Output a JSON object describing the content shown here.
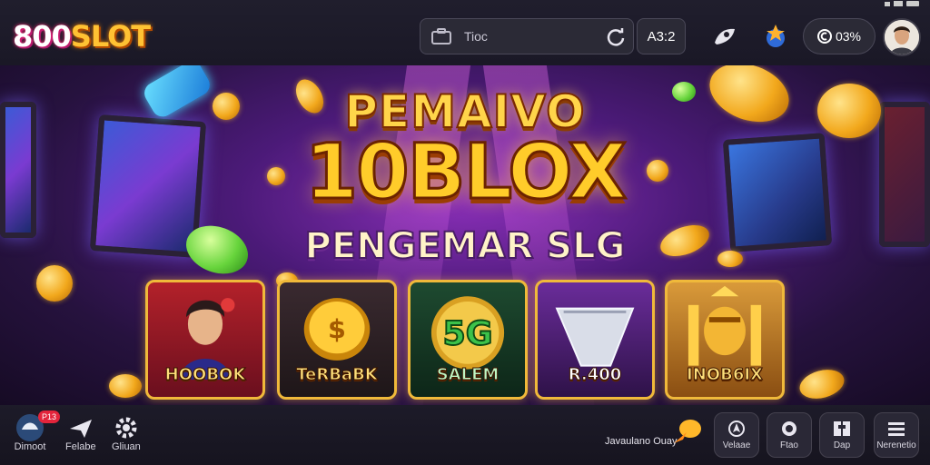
{
  "header": {
    "logo_part1": "800",
    "logo_part2": "SLOT",
    "search_text": "Tioc",
    "code_label": "A3:2",
    "balance": "03%"
  },
  "hero": {
    "line1": "PEMAIVO",
    "line2": "10BLOX",
    "line3": "PENGEMAR SLG"
  },
  "cards": [
    {
      "label": "HOOBOK",
      "icon": "hero-character-icon"
    },
    {
      "label": "TeRBaBK",
      "icon": "gold-coin-icon"
    },
    {
      "label": "SALEM",
      "icon": "5g-coin-icon",
      "big": "5G"
    },
    {
      "label": "R.400",
      "icon": "silver-basket-icon"
    },
    {
      "label": "INOB6IX",
      "icon": "golden-idol-icon"
    }
  ],
  "bottom_nav": {
    "items": [
      {
        "label": "Dimoot",
        "badge": "P13"
      },
      {
        "label": "Felabe"
      },
      {
        "label": "Gliuan"
      }
    ],
    "bonus_text": "Javaulano Ouay",
    "buttons": [
      {
        "label": "Velaae"
      },
      {
        "label": "Ftao"
      },
      {
        "label": "Dap"
      },
      {
        "label": "Nerenetio"
      }
    ]
  },
  "colors": {
    "accent_gold": "#ffcc2a",
    "bg_dark": "#1a1826",
    "hero_purple": "#8a2fb8"
  }
}
